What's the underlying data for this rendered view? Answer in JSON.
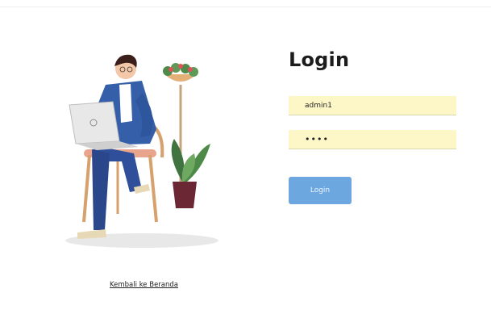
{
  "login": {
    "title": "Login",
    "username_value": "admin1",
    "password_value": "••••",
    "button_label": "Login"
  },
  "footer": {
    "back_link": "Kembali ke Beranda"
  },
  "colors": {
    "input_background": "#fdf6c6",
    "button_background": "#6da7e0",
    "title_text": "#1c1c1c"
  },
  "icons": {
    "illustration": "person-with-laptop-on-chair-illustration"
  }
}
